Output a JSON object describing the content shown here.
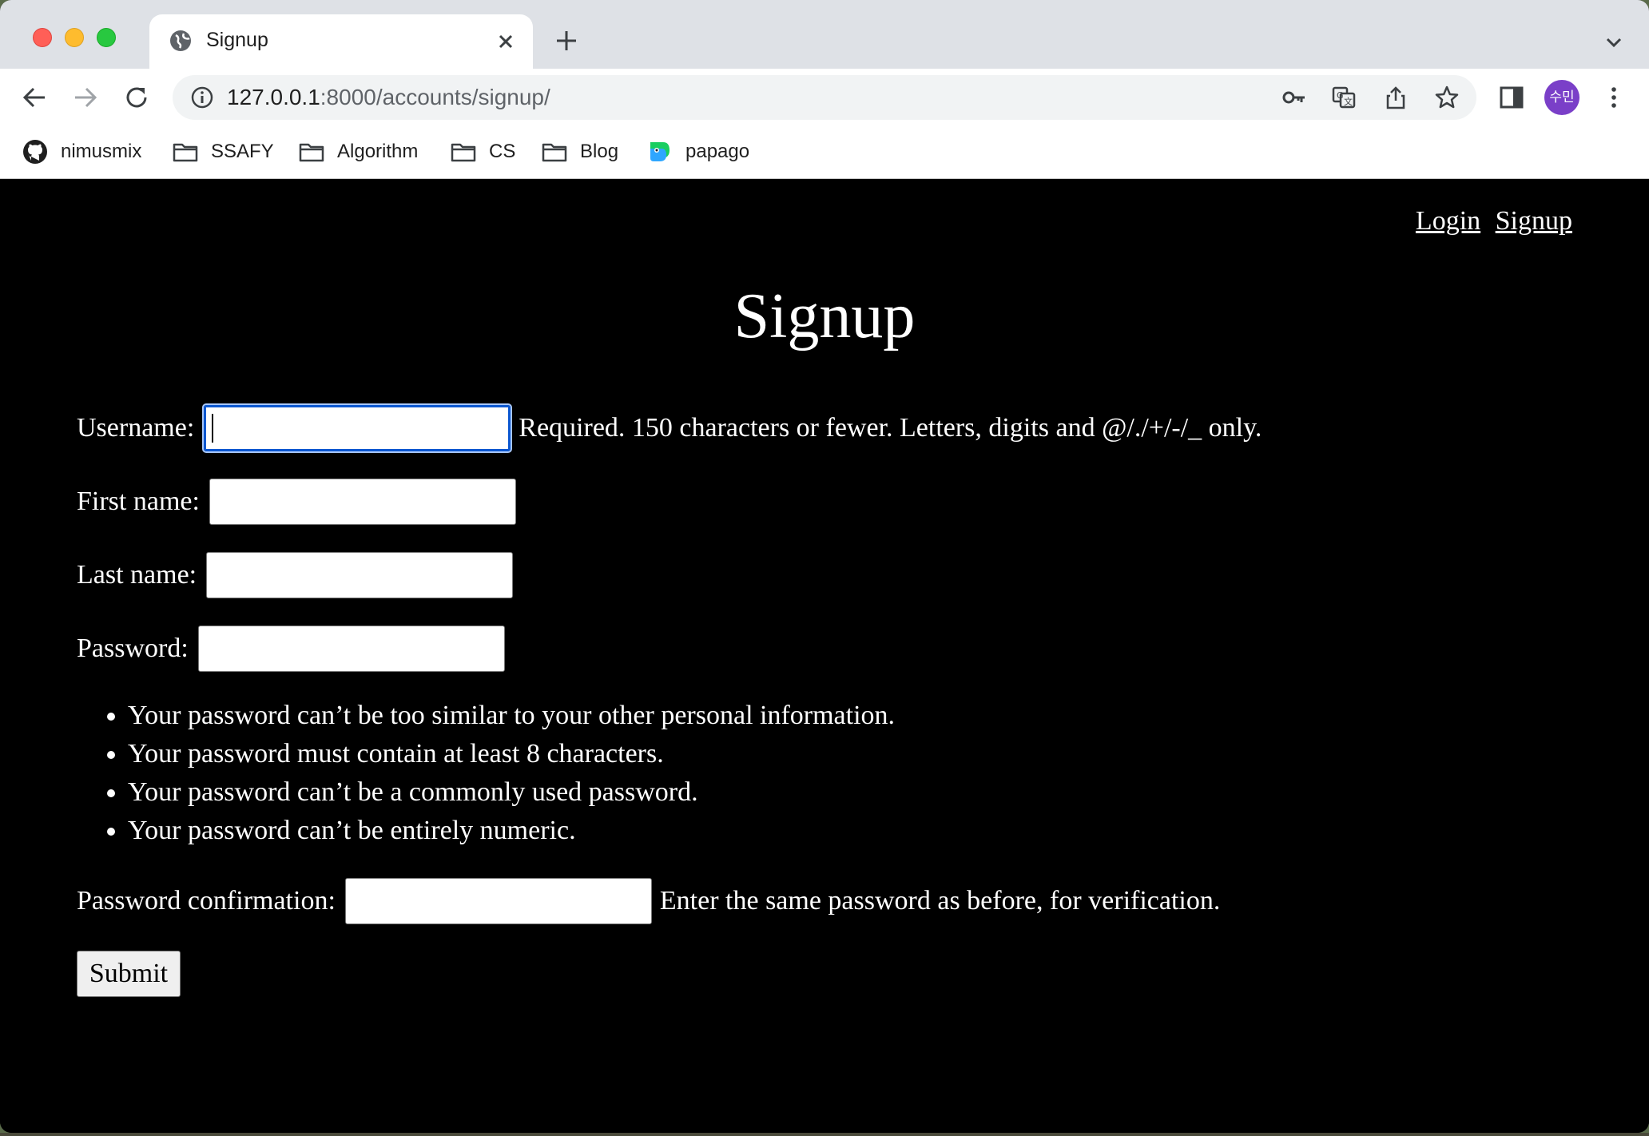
{
  "browser": {
    "tab": {
      "title": "Signup"
    },
    "omnibox": {
      "url_host": "127.0.0.1",
      "url_path": ":8000/accounts/signup/"
    },
    "avatar_text": "수민",
    "bookmarks": [
      {
        "label": "nimusmix",
        "icon": "github-icon"
      },
      {
        "label": "SSAFY",
        "icon": "folder-icon"
      },
      {
        "label": "Algorithm",
        "icon": "folder-icon"
      },
      {
        "label": "CS",
        "icon": "folder-icon"
      },
      {
        "label": "Blog",
        "icon": "folder-icon"
      },
      {
        "label": "papago",
        "icon": "papago-icon"
      }
    ]
  },
  "page": {
    "nav": {
      "login": "Login",
      "signup": "Signup"
    },
    "title": "Signup",
    "fields": {
      "username": {
        "label": "Username:",
        "value": "",
        "help": "Required. 150 characters or fewer. Letters, digits and @/./+/-/_ only."
      },
      "first_name": {
        "label": "First name:",
        "value": ""
      },
      "last_name": {
        "label": "Last name:",
        "value": ""
      },
      "password": {
        "label": "Password:",
        "value": ""
      },
      "password_confirmation": {
        "label": "Password confirmation:",
        "value": "",
        "help": "Enter the same password as before, for verification."
      }
    },
    "password_rules": [
      "Your password can’t be too similar to your other personal information.",
      "Your password must contain at least 8 characters.",
      "Your password can’t be a commonly used password.",
      "Your password can’t be entirely numeric."
    ],
    "submit_label": "Submit"
  }
}
